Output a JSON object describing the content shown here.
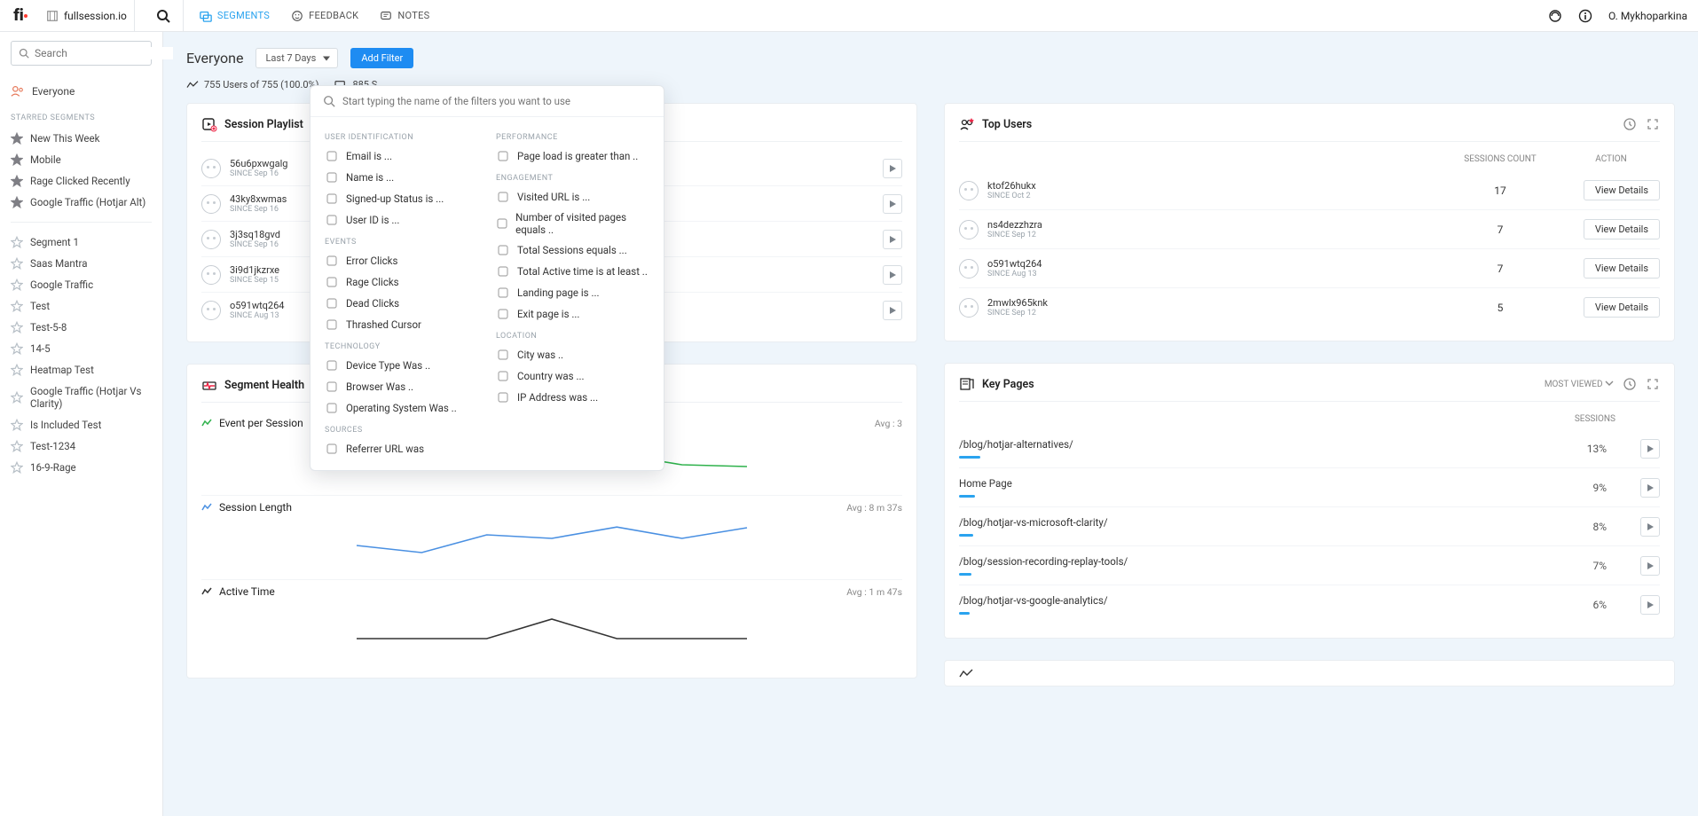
{
  "topbar": {
    "site": "fullsession.io",
    "nav": {
      "segments": "SEGMENTS",
      "feedback": "FEEDBACK",
      "notes": "NOTES"
    },
    "user": "O. Mykhoparkina"
  },
  "sidebar": {
    "search_placeholder": "Search",
    "everyone": "Everyone",
    "starred_label": "STARRED SEGMENTS",
    "starred": [
      "New This Week",
      "Mobile",
      "Rage Clicked Recently",
      "Google Traffic (Hotjar Alt)"
    ],
    "segments": [
      "Segment 1",
      "Saas Mantra",
      "Google Traffic",
      "Test",
      "Test-5-8",
      "14-5",
      "Heatmap Test",
      "Google Traffic (Hotjar Vs Clarity)",
      "Is Included Test",
      "Test-1234",
      "16-9-Rage"
    ]
  },
  "header": {
    "title": "Everyone",
    "range": "Last 7 Days",
    "add_filter": "Add Filter"
  },
  "stats": {
    "users": "755 Users of 755 (100.0%)",
    "sessions_prefix": "885 S"
  },
  "filter_popover": {
    "placeholder": "Start typing the name of the filters you want to use",
    "left": [
      {
        "cat": "USER IDENTIFICATION",
        "items": [
          "Email is ...",
          "Name is ...",
          "Signed-up Status is ...",
          "User ID is ..."
        ]
      },
      {
        "cat": "EVENTS",
        "items": [
          "Error Clicks",
          "Rage Clicks",
          "Dead Clicks",
          "Thrashed Cursor"
        ]
      },
      {
        "cat": "TECHNOLOGY",
        "items": [
          "Device Type Was ..",
          "Browser Was ..",
          "Operating System Was .."
        ]
      },
      {
        "cat": "SOURCES",
        "items": [
          "Referrer URL was"
        ]
      }
    ],
    "right": [
      {
        "cat": "PERFORMANCE",
        "items": [
          "Page load is greater than .."
        ]
      },
      {
        "cat": "ENGAGEMENT",
        "items": [
          "Visited URL is ...",
          "Number of visited pages equals ..",
          "Total Sessions equals ...",
          "Total Active time is at least ..",
          "Landing page is ...",
          "Exit page is ..."
        ]
      },
      {
        "cat": "LOCATION",
        "items": [
          "City was ..",
          "Country was ...",
          "IP Address was ..."
        ]
      }
    ]
  },
  "session_playlist": {
    "title": "Session Playlist",
    "rows": [
      {
        "id": "56u6pxwgalg",
        "since": "SINCE Sep 16"
      },
      {
        "id": "43ky8xwmas",
        "since": "SINCE Sep 16"
      },
      {
        "id": "3j3sq18gvd",
        "since": "SINCE Sep 16"
      },
      {
        "id": "3i9d1jkzrxe",
        "since": "SINCE Sep 15"
      },
      {
        "id": "o591wtq264",
        "since": "SINCE Aug 13"
      }
    ]
  },
  "top_users": {
    "title": "Top Users",
    "head": {
      "sessions": "SESSIONS COUNT",
      "action": "ACTION"
    },
    "view_label": "View Details",
    "rows": [
      {
        "id": "ktof26hukx",
        "since": "SINCE Oct 2",
        "count": "17"
      },
      {
        "id": "ns4dezzhzra",
        "since": "SINCE Sep 12",
        "count": "7"
      },
      {
        "id": "o591wtq264",
        "since": "SINCE Aug 13",
        "count": "7"
      },
      {
        "id": "2mwlx965knk",
        "since": "SINCE Sep 12",
        "count": "5"
      }
    ]
  },
  "segment_health": {
    "title": "Segment Health",
    "blocks": [
      {
        "label": "Event per Session",
        "avg": "Avg : 3",
        "color": "#2fb24c"
      },
      {
        "label": "Session Length",
        "avg": "Avg : 8 m 37s",
        "color": "#4a90e2"
      },
      {
        "label": "Active Time",
        "avg": "Avg : 1 m 47s",
        "color": "#333"
      }
    ]
  },
  "key_pages": {
    "title": "Key Pages",
    "sort": "MOST VIEWED",
    "head": "SESSIONS",
    "rows": [
      {
        "page": "/blog/hotjar-alternatives/",
        "pct": "13%",
        "bar": 24
      },
      {
        "page": "Home Page",
        "pct": "9%",
        "bar": 18
      },
      {
        "page": "/blog/hotjar-vs-microsoft-clarity/",
        "pct": "8%",
        "bar": 16
      },
      {
        "page": "/blog/session-recording-replay-tools/",
        "pct": "7%",
        "bar": 14
      },
      {
        "page": "/blog/hotjar-vs-google-analytics/",
        "pct": "6%",
        "bar": 12
      }
    ]
  },
  "chart_data": [
    {
      "type": "line",
      "title": "Event per Session",
      "values": [
        2.6,
        2.4,
        3.4,
        3.0,
        3.2,
        2.6,
        2.5
      ],
      "ylim": [
        2,
        4
      ]
    },
    {
      "type": "line",
      "title": "Session Length",
      "values": [
        7.0,
        6.0,
        8.5,
        8.0,
        9.6,
        8.0,
        9.5
      ],
      "ylim": [
        5,
        10
      ]
    },
    {
      "type": "line",
      "title": "Active Time",
      "values": [
        1.3,
        1.3,
        1.3,
        2.4,
        1.3,
        1.3,
        1.3
      ],
      "ylim": [
        1,
        3
      ]
    }
  ]
}
